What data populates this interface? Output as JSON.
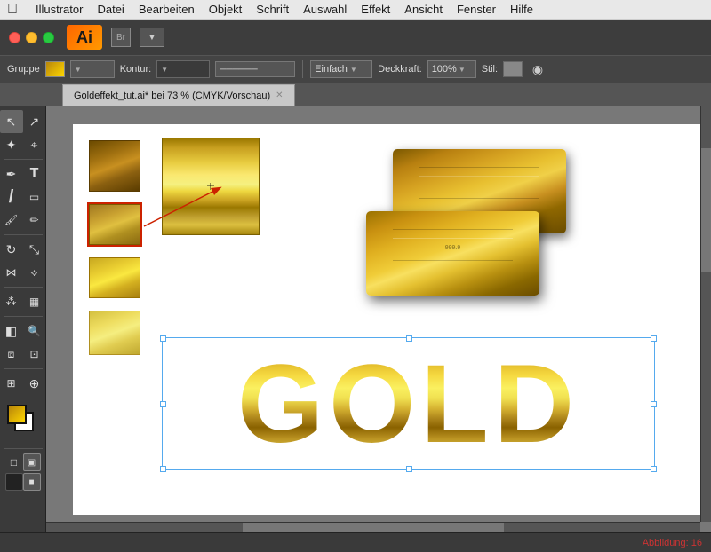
{
  "menubar": {
    "apple": "&#63743;",
    "items": [
      "Illustrator",
      "Datei",
      "Bearbeiten",
      "Objekt",
      "Schrift",
      "Auswahl",
      "Effekt",
      "Ansicht",
      "Fenster",
      "Hilfe"
    ]
  },
  "titlebar": {
    "logo_text": "Ai",
    "window_title": "Goldeffekt_tut.ai* bei 73 % (CMYK/Vorschau)"
  },
  "optionsbar": {
    "group_label": "Gruppe",
    "kontur_label": "Kontur:",
    "stroke_style": "Einfach",
    "deckkraft_label": "Deckkraft:",
    "deckkraft_value": "100%",
    "stil_label": "Stil:"
  },
  "canvas": {
    "background": "#787878"
  },
  "statusbar": {
    "figure_label": "Abbildung: 16"
  },
  "tools": {
    "items": [
      {
        "name": "select-tool",
        "icon": "↖"
      },
      {
        "name": "direct-select-tool",
        "icon": "↗"
      },
      {
        "name": "magic-wand-tool",
        "icon": "✦"
      },
      {
        "name": "lasso-tool",
        "icon": "⌖"
      },
      {
        "name": "pen-tool",
        "icon": "✒"
      },
      {
        "name": "type-tool",
        "icon": "T"
      },
      {
        "name": "line-tool",
        "icon": "\\"
      },
      {
        "name": "rectangle-tool",
        "icon": "▭"
      },
      {
        "name": "paintbrush-tool",
        "icon": "🖌"
      },
      {
        "name": "pencil-tool",
        "icon": "✏"
      },
      {
        "name": "rotate-tool",
        "icon": "↻"
      },
      {
        "name": "scale-tool",
        "icon": "⤡"
      },
      {
        "name": "symbol-tool",
        "icon": "⁑"
      },
      {
        "name": "graph-tool",
        "icon": "▦"
      },
      {
        "name": "gradient-tool",
        "icon": "◫"
      },
      {
        "name": "eyedropper-tool",
        "icon": "🔍"
      },
      {
        "name": "zoom-tool",
        "icon": "⊕"
      }
    ]
  }
}
